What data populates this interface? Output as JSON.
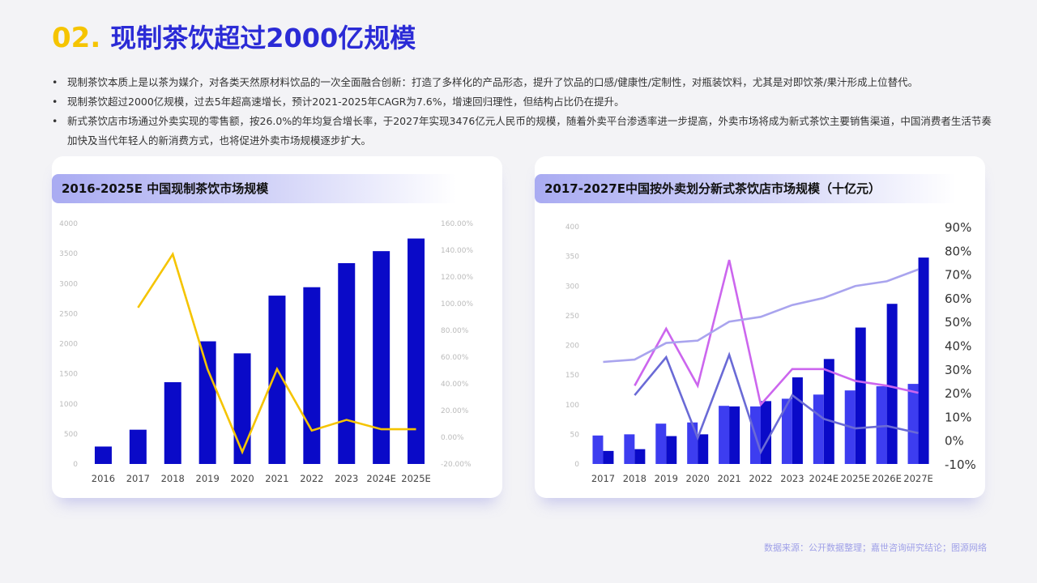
{
  "header": {
    "number": "02.",
    "title": "现制茶饮超过2000亿规模"
  },
  "bullets": [
    "现制茶饮本质上是以茶为媒介，对各类天然原材料饮品的一次全面融合创新：打造了多样化的产品形态，提升了饮品的口感/健康性/定制性，对瓶装饮料，尤其是对即饮茶/果汁形成上位替代。",
    "现制茶饮超过2000亿规模，过去5年超高速增长，预计2021-2025年CAGR为7.6%，增速回归理性，但结构占比仍在提升。",
    "新式茶饮店市场通过外卖实现的零售额，按26.0%的年均复合增长率，于2027年实现3476亿元人民币的规模，随着外卖平台渗透率进一步提高，外卖市场将成为新式茶饮主要销售渠道，中国消费者生活节奏加快及当代年轻人的新消费方式，也将促进外卖市场规模逐步扩大。"
  ],
  "source": "数据来源：公开数据整理；嘉世咨询研究结论；图源网络",
  "colors": {
    "bar_dark": "#0a0ac8",
    "bar_light": "#3d3df0",
    "line_yellow": "#f5c400",
    "line_violet": "#cc66ee",
    "line_lavender": "#a9a4ee",
    "line_slate": "#6a6ad6"
  },
  "chart_data": [
    {
      "type": "bar",
      "title": "2016-2025E 中国现制茶饮市场规模",
      "categories": [
        "2016",
        "2017",
        "2018",
        "2019",
        "2020",
        "2021",
        "2022",
        "2023",
        "2024E",
        "2025E"
      ],
      "y_ticks": [
        "4000",
        "3500",
        "3000",
        "2500",
        "2000",
        "1500",
        "1000",
        "500",
        "0"
      ],
      "y2_ticks": [
        "160.00%",
        "140.00%",
        "120.00%",
        "100.00%",
        "80.00%",
        "60.00%",
        "40.00%",
        "20.00%",
        "0.00%",
        "-20.00%"
      ],
      "ylim": [
        0,
        4000
      ],
      "y2lim": [
        -20,
        160
      ],
      "series": [
        {
          "type": "bar",
          "values": [
            290,
            570,
            1360,
            2040,
            1840,
            2800,
            2940,
            3340,
            3540,
            3750
          ]
        },
        {
          "type": "line",
          "axis": "right",
          "values": [
            null,
            97,
            137,
            51,
            -11,
            51,
            5,
            13,
            6,
            6
          ]
        }
      ]
    },
    {
      "type": "bar",
      "title": "2017-2027E中国按外卖划分新式茶饮店市场规模（十亿元）",
      "categories": [
        "2017",
        "2018",
        "2019",
        "2020",
        "2021",
        "2022",
        "2023",
        "2024E",
        "2025E",
        "2026E",
        "2027E"
      ],
      "y_ticks": [
        "400",
        "350",
        "300",
        "250",
        "200",
        "150",
        "100",
        "50",
        "0"
      ],
      "y2_ticks": [
        "90%",
        "80%",
        "70%",
        "60%",
        "50%",
        "40%",
        "30%",
        "20%",
        "10%",
        "0%",
        "-10%"
      ],
      "ylim": [
        0,
        400
      ],
      "y2lim": [
        -10,
        90
      ],
      "series": [
        {
          "type": "bar",
          "values": [
            48,
            50,
            68,
            70,
            98,
            97,
            110,
            117,
            124,
            131,
            135
          ]
        },
        {
          "type": "bar",
          "values": [
            22,
            25,
            47,
            50,
            97,
            106,
            146,
            177,
            230,
            270,
            348
          ]
        },
        {
          "type": "line",
          "axis": "right",
          "values": [
            null,
            23,
            47,
            23,
            76,
            15,
            30,
            30,
            25,
            23,
            20
          ]
        },
        {
          "type": "line",
          "axis": "right",
          "values": [
            null,
            19,
            35,
            1,
            36,
            -5,
            19,
            9,
            5,
            6,
            3
          ]
        },
        {
          "type": "line",
          "axis": "right",
          "values": [
            33,
            34,
            41,
            42,
            50,
            52,
            57,
            60,
            65,
            67,
            72
          ]
        }
      ]
    }
  ]
}
